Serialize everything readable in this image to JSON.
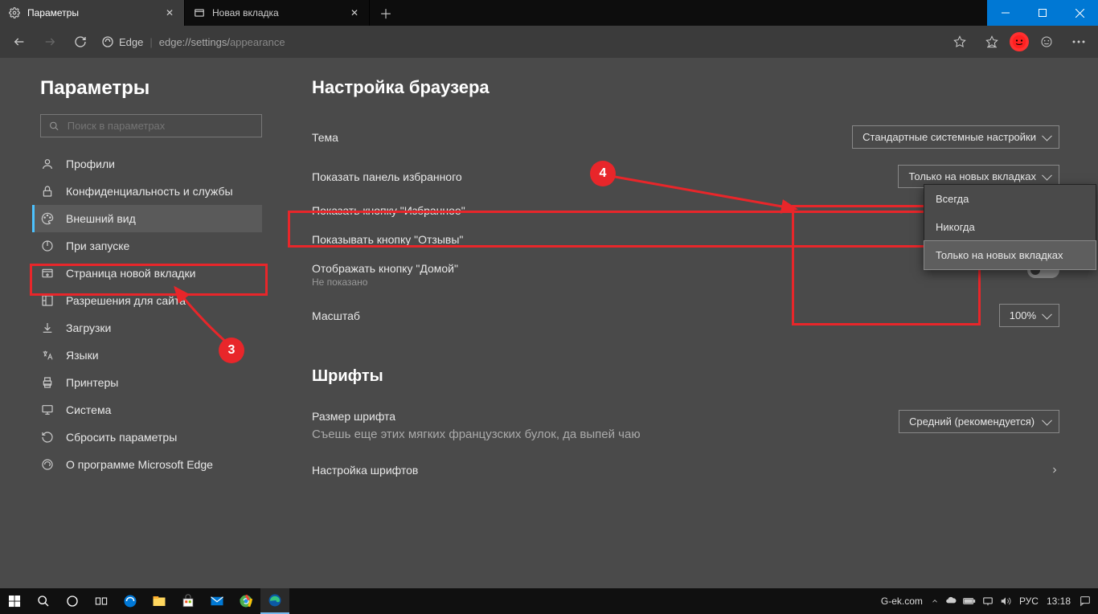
{
  "window": {
    "tabs": [
      {
        "label": "Параметры",
        "active": true,
        "icon": "settings"
      },
      {
        "label": "Новая вкладка",
        "active": false,
        "icon": "newtab"
      }
    ],
    "controls": {
      "min": "—",
      "max": "▢",
      "close": "✕"
    }
  },
  "toolbar": {
    "edge_label": "Edge",
    "url_prefix": "edge://settings/",
    "url_suffix": "appearance"
  },
  "sidebar": {
    "title": "Параметры",
    "search_placeholder": "Поиск в параметрах",
    "items": [
      {
        "label": "Профили",
        "icon": "user"
      },
      {
        "label": "Конфиденциальность и службы",
        "icon": "lock"
      },
      {
        "label": "Внешний вид",
        "icon": "appearance",
        "active": true
      },
      {
        "label": "При запуске",
        "icon": "power"
      },
      {
        "label": "Страница новой вкладки",
        "icon": "newtab"
      },
      {
        "label": "Разрешения для сайта",
        "icon": "permissions"
      },
      {
        "label": "Загрузки",
        "icon": "download"
      },
      {
        "label": "Языки",
        "icon": "language"
      },
      {
        "label": "Принтеры",
        "icon": "printer"
      },
      {
        "label": "Система",
        "icon": "system"
      },
      {
        "label": "Сбросить параметры",
        "icon": "reset"
      },
      {
        "label": "О программе Microsoft Edge",
        "icon": "edge"
      }
    ]
  },
  "settings": {
    "section1_title": "Настройка браузера",
    "theme_label": "Тема",
    "theme_value": "Стандартные системные настройки",
    "favbar_label": "Показать панель избранного",
    "favbar_value": "Только на новых вкладках",
    "favbar_options": [
      "Всегда",
      "Никогда",
      "Только на новых вкладках"
    ],
    "favbtn_label": "Показать кнопку \"Избранное\"",
    "feedback_label": "Показывать кнопку \"Отзывы\"",
    "home_label": "Отображать кнопку \"Домой\"",
    "home_sub": "Не показано",
    "zoom_label": "Масштаб",
    "zoom_value": "100%",
    "section2_title": "Шрифты",
    "fontsize_label": "Размер шрифта",
    "fontsize_value": "Средний (рекомендуется)",
    "fontsize_sub": "Съешь еще этих мягких французских булок, да выпей чаю",
    "fontcustom_label": "Настройка шрифтов"
  },
  "annotations": {
    "badge3": "3",
    "badge4": "4"
  },
  "taskbar": {
    "site": "G-ek.com",
    "lang": "РУС",
    "time": "13:18"
  }
}
